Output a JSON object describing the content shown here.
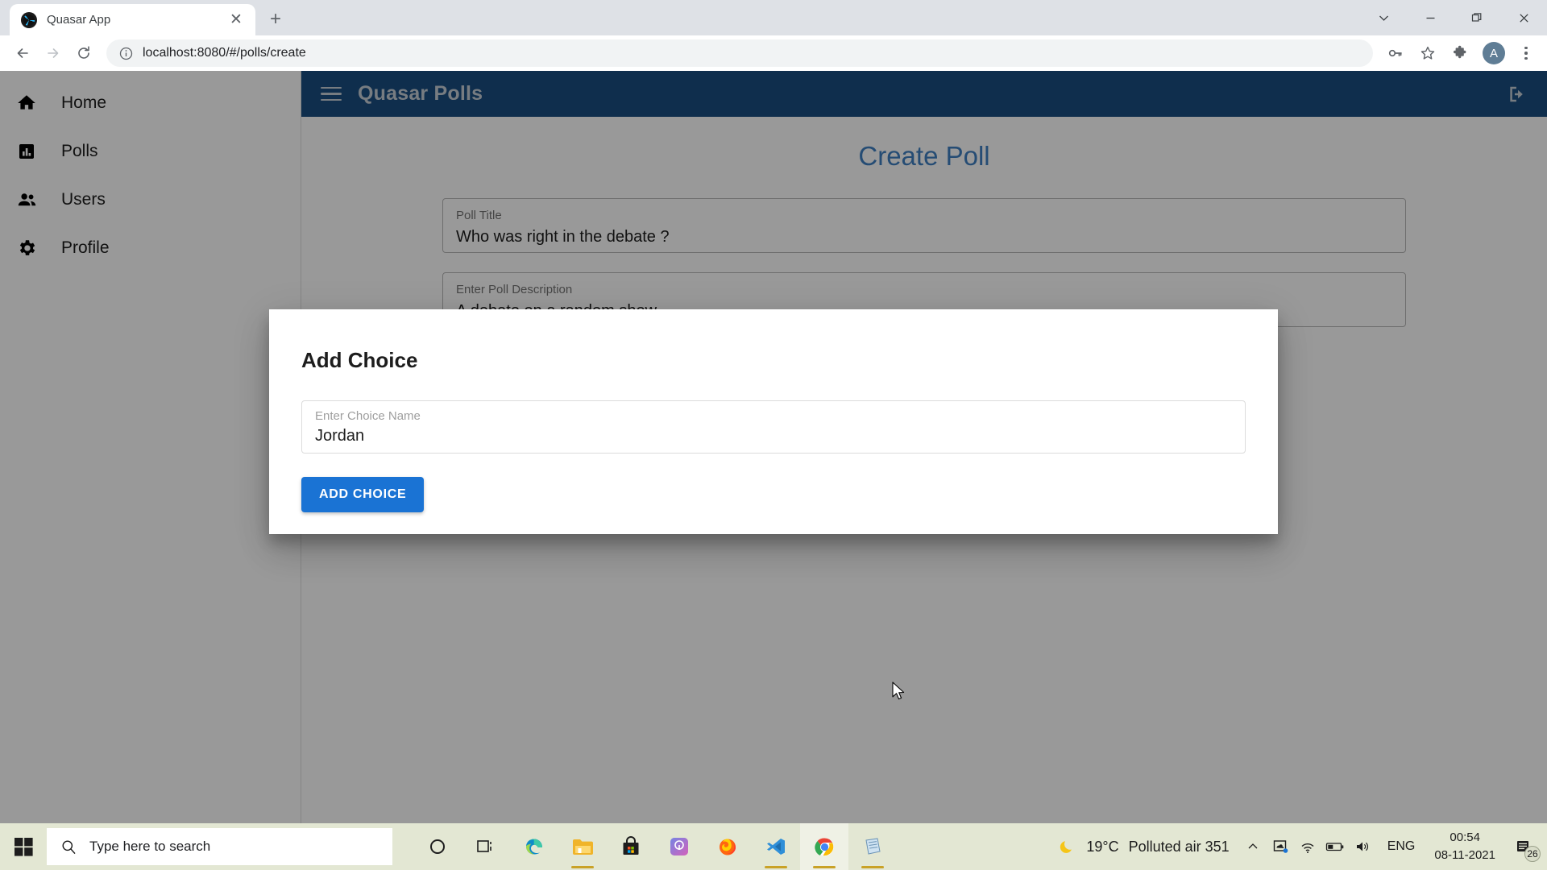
{
  "browser": {
    "tab": {
      "title": "Quasar App",
      "favicon": "quasar-logo-icon",
      "close": "✕"
    },
    "new_tab_label": "+",
    "window_controls": {
      "chevron": "chevron-down",
      "minimize": "minimize",
      "restore": "restore",
      "close": "close"
    },
    "toolbar": {
      "back": "back-arrow",
      "forward": "forward-arrow",
      "reload": "reload",
      "site_info": "info-circle",
      "url": "localhost:8080/#/polls/create",
      "password_icon": "key-icon",
      "bookmark_icon": "star-icon",
      "extensions_icon": "puzzle-icon",
      "profile_initial": "A",
      "menu_icon": "kebab-menu"
    }
  },
  "sidebar": {
    "items": [
      {
        "label": "Home",
        "icon": "home-icon"
      },
      {
        "label": "Polls",
        "icon": "bar-chart-icon"
      },
      {
        "label": "Users",
        "icon": "people-icon"
      },
      {
        "label": "Profile",
        "icon": "gear-icon"
      }
    ]
  },
  "appbar": {
    "menu_icon": "hamburger-icon",
    "title": "Quasar Polls",
    "logout_icon": "logout-icon"
  },
  "page": {
    "title": "Create Poll",
    "fields": [
      {
        "label": "Poll Title",
        "value": "Who was right in the debate ?"
      },
      {
        "label": "Enter Poll Description",
        "value": "A debate on a random show"
      }
    ]
  },
  "dialog": {
    "title": "Add Choice",
    "field": {
      "label": "Enter Choice Name",
      "value": "Jordan",
      "placeholder": "Enter Choice Name"
    },
    "button_label": "ADD CHOICE",
    "accent_color": "#1a73d4"
  },
  "taskbar": {
    "start_icon": "windows-start-icon",
    "search_placeholder": "Type here to search",
    "search_icon": "search-icon",
    "apps": [
      {
        "name": "cortana-icon",
        "active": false,
        "running": false
      },
      {
        "name": "task-view-icon",
        "active": false,
        "running": false
      },
      {
        "name": "edge-icon",
        "active": false,
        "running": false
      },
      {
        "name": "file-explorer-icon",
        "active": false,
        "running": true
      },
      {
        "name": "microsoft-store-icon",
        "active": false,
        "running": false
      },
      {
        "name": "app-icon",
        "active": false,
        "running": false
      },
      {
        "name": "firefox-icon",
        "active": false,
        "running": false
      },
      {
        "name": "vscode-icon",
        "active": false,
        "running": true
      },
      {
        "name": "chrome-icon",
        "active": true,
        "running": true
      },
      {
        "name": "notepad-icon",
        "active": false,
        "running": true
      }
    ],
    "tray": {
      "weather_icon": "moon-icon",
      "temperature": "19°C",
      "air_quality": "Polluted air 351",
      "overflow_icon": "chevron-up-icon",
      "onedrive_icon": "onedrive-icon",
      "network_icon": "wifi-icon",
      "battery_icon": "battery-icon",
      "volume_icon": "speaker-icon",
      "language": "ENG",
      "time": "00:54",
      "date": "08-11-2021",
      "notifications_icon": "notification-icon",
      "notifications_count": "26"
    }
  }
}
